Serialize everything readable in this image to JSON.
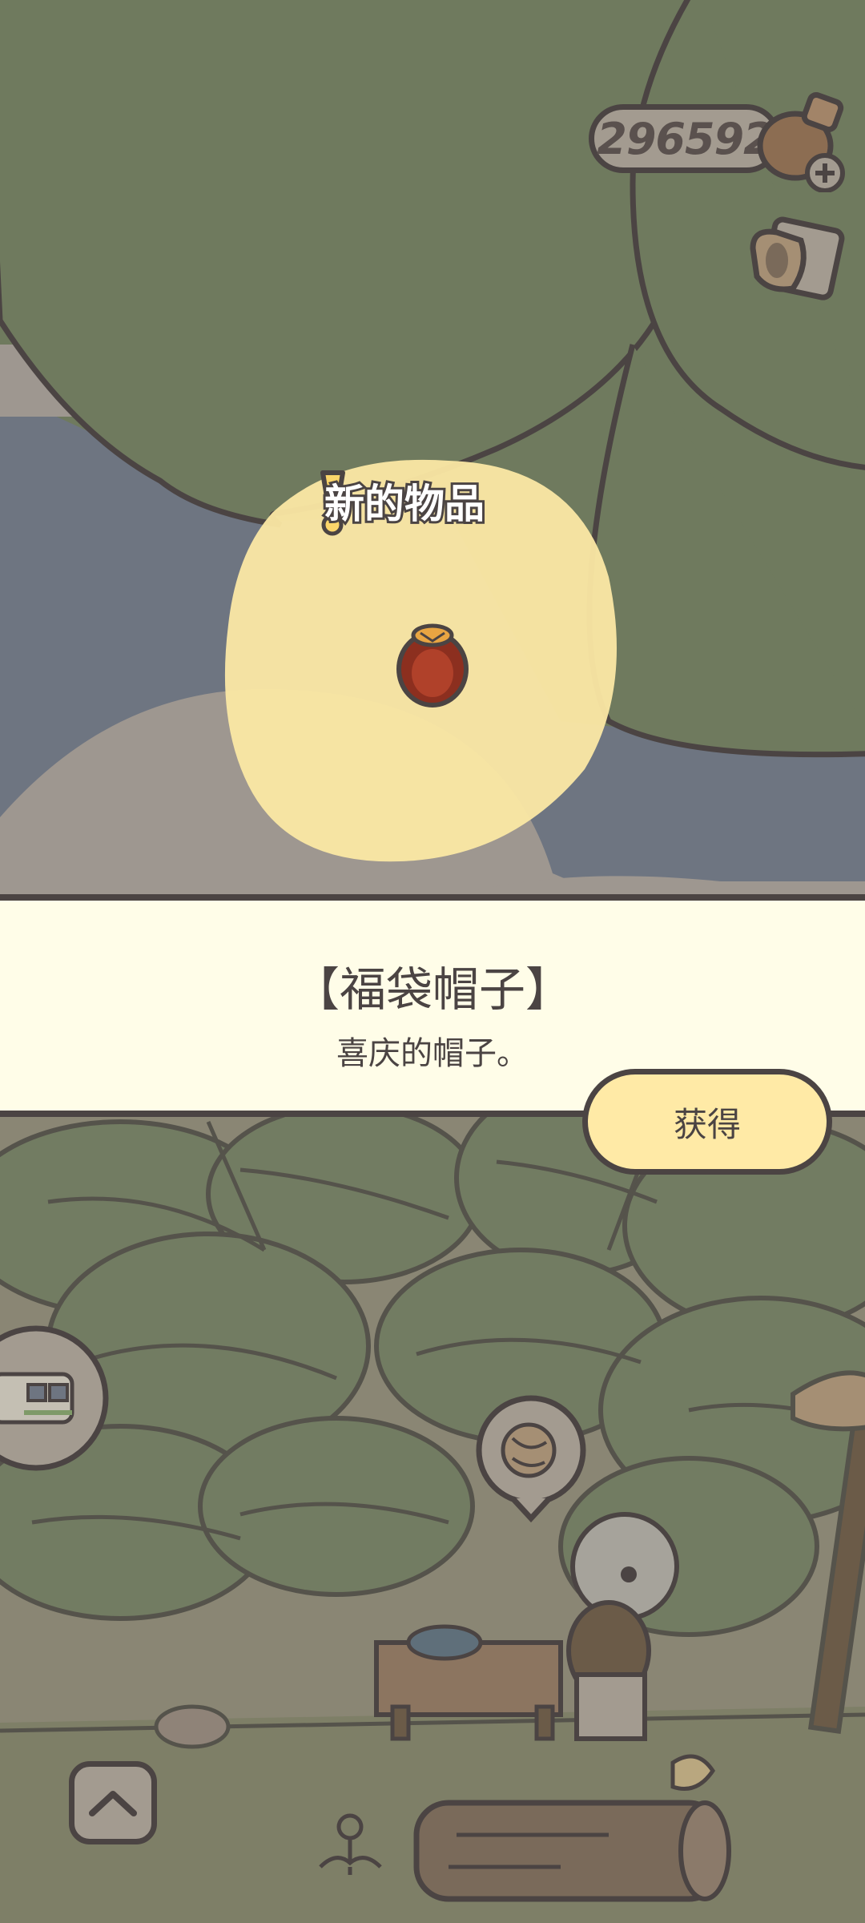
{
  "hud": {
    "clover_count": "296592",
    "clover_icon": "clover-plus-icon",
    "inventory_icon": "cup-icon"
  },
  "popup": {
    "badge_text": "新的物品",
    "badge_icon": "exclamation-icon",
    "item_icon": "lucky-bag-hat-icon"
  },
  "panel": {
    "item_name": "【福袋帽子】",
    "item_description": "喜庆的帽子。",
    "obtain_button": "获得"
  },
  "scene": {
    "home_button_icon": "chevron-up-icon",
    "train_icon": "train-bubble-icon",
    "yarn_bubble_icon": "yarn-ball-icon"
  },
  "colors": {
    "outline": "#4b4443",
    "panel_bg": "#fffde8",
    "button_bg": "#ffeaa6",
    "highlight": "#fbe8a4",
    "foliage": "#6f7a5e"
  }
}
